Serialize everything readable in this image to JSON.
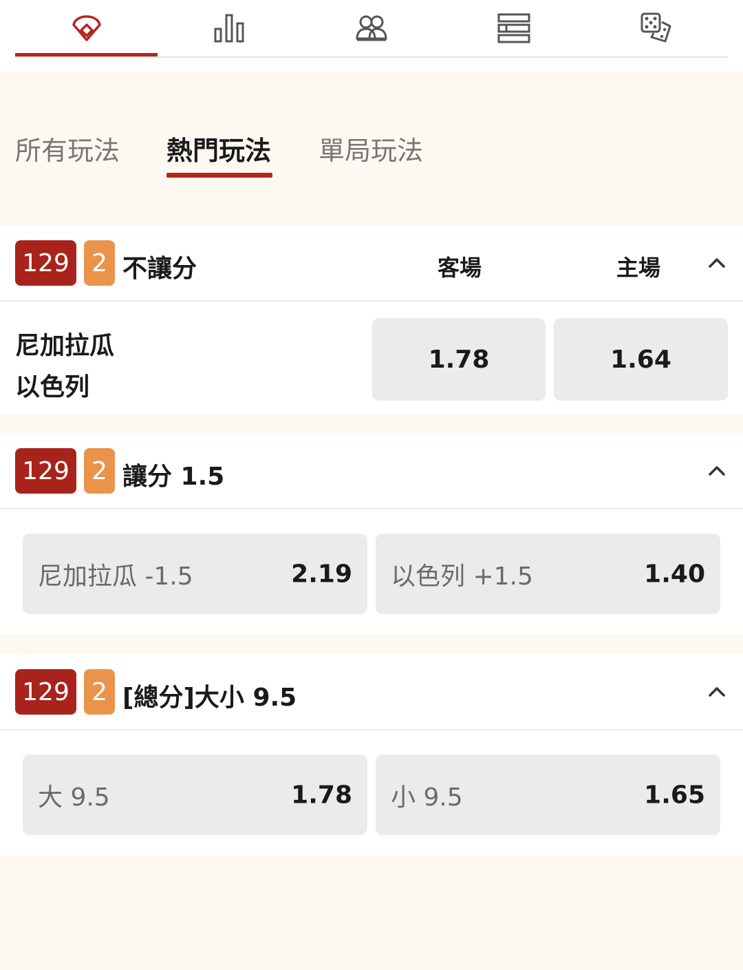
{
  "colors": {
    "accent": "#b3261e",
    "badge_match": "#a8231c",
    "badge_inning": "#e9944a",
    "odds_bg": "#ebebeb",
    "page_bg": "#fdf9f1"
  },
  "icon_tabs": [
    {
      "icon": "baseball-diamond-icon",
      "active": true
    },
    {
      "icon": "bar-chart-icon",
      "active": false
    },
    {
      "icon": "players-icon",
      "active": false
    },
    {
      "icon": "list-rows-icon",
      "active": false
    },
    {
      "icon": "dice-icon",
      "active": false
    }
  ],
  "text_tabs": [
    {
      "label": "所有玩法",
      "active": false
    },
    {
      "label": "熱門玩法",
      "active": true
    },
    {
      "label": "單局玩法",
      "active": false
    }
  ],
  "markets": [
    {
      "match_no": "129",
      "inning": "2",
      "title": "不讓分",
      "col_away": "客場",
      "col_home": "主場",
      "teams": [
        "尼加拉瓜",
        "以色列"
      ],
      "odds": [
        "1.78",
        "1.64"
      ]
    },
    {
      "match_no": "129",
      "inning": "2",
      "title": "讓分 1.5",
      "selections": [
        {
          "label": "尼加拉瓜 -1.5",
          "odds": "2.19"
        },
        {
          "label": "以色列 +1.5",
          "odds": "1.40"
        }
      ]
    },
    {
      "match_no": "129",
      "inning": "2",
      "title": "[總分]大小 9.5",
      "selections": [
        {
          "label": "大 9.5",
          "odds": "1.78"
        },
        {
          "label": "小 9.5",
          "odds": "1.65"
        }
      ]
    }
  ]
}
